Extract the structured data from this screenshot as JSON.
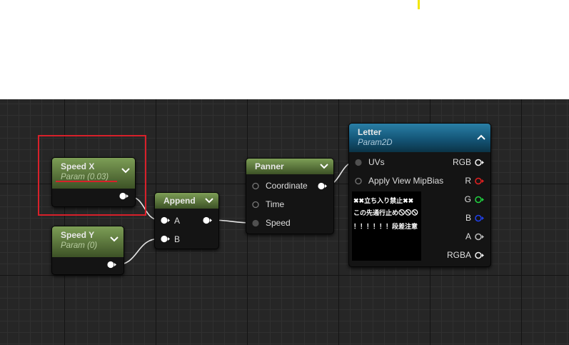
{
  "nodes": {
    "speed_x": {
      "title": "Speed X",
      "subtitle": "Param (0.03)"
    },
    "speed_y": {
      "title": "Speed Y",
      "subtitle": "Param (0)"
    },
    "append": {
      "title": "Append",
      "inputs": [
        "A",
        "B"
      ]
    },
    "panner": {
      "title": "Panner",
      "inputs": [
        "Coordinate",
        "Time",
        "Speed"
      ]
    },
    "letter": {
      "title": "Letter",
      "subtitle": "Param2D",
      "input": "UVs",
      "option": "Apply View MipBias",
      "outputs": [
        "RGB",
        "R",
        "G",
        "B",
        "A",
        "RGBA"
      ],
      "texture_text": [
        "✖✖立ち入り禁止✖✖",
        "この先通行止め🛇🛇🛇",
        "！！！！！！段差注意"
      ]
    }
  },
  "colors": {
    "param_header": "#6b8a4a",
    "texture_header": "#1e6c8f",
    "pin_r": "#e02020",
    "pin_g": "#20d040",
    "pin_b": "#2040e8",
    "highlight": "#d8202a",
    "grid_bg": "#262626"
  }
}
